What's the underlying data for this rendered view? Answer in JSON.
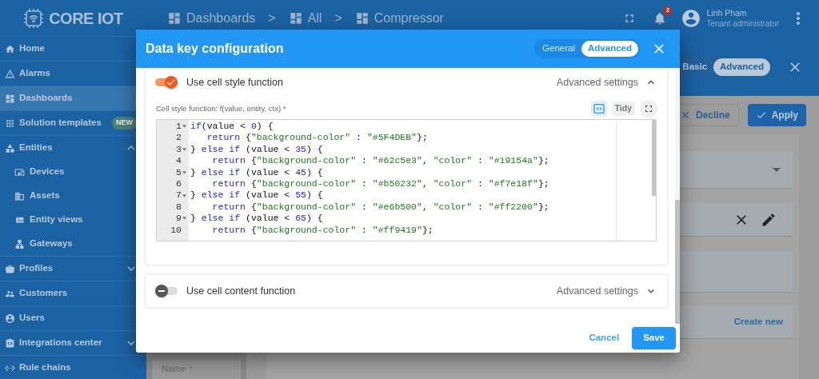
{
  "header": {
    "logo": "CORE IOT",
    "breadcrumbs": [
      "Dashboards",
      "All",
      "Compressor"
    ],
    "separator": ">",
    "notification_count": "2",
    "user": {
      "name": "Linh Phạm",
      "role": "Tenant administrator"
    }
  },
  "sidebar": {
    "items": [
      {
        "label": "Home",
        "selected": false
      },
      {
        "label": "Alarms",
        "selected": false
      },
      {
        "label": "Dashboards",
        "selected": true
      },
      {
        "label": "Solution templates",
        "selected": false,
        "badge": "NEW"
      },
      {
        "label": "Entities",
        "selected": false,
        "expanded": true,
        "children": [
          {
            "label": "Devices",
            "selected": false
          },
          {
            "label": "Assets",
            "selected": false
          },
          {
            "label": "Entity views",
            "selected": false
          },
          {
            "label": "Gateways",
            "selected": false
          }
        ]
      },
      {
        "label": "Profiles",
        "selected": false,
        "expanded": false
      },
      {
        "label": "Customers",
        "selected": false
      },
      {
        "label": "Users",
        "selected": false
      },
      {
        "label": "Integrations center",
        "selected": false,
        "expanded": false
      },
      {
        "label": "Rule chains",
        "selected": false
      }
    ]
  },
  "widget_editor": {
    "tabs": [
      {
        "label": "Basic",
        "selected": false
      },
      {
        "label": "Advanced",
        "selected": true
      }
    ],
    "decline": "Decline",
    "apply": "Apply",
    "create_new": "Create new",
    "column": "Name ↑"
  },
  "dialog": {
    "title": "Data key configuration",
    "tabs": [
      {
        "label": "General",
        "selected": false
      },
      {
        "label": "Advanced",
        "selected": true
      }
    ],
    "sections": [
      {
        "label": "Use cell style function",
        "on": true,
        "expanded": true,
        "settings": "Advanced settings",
        "editor": {
          "label": "Cell style function: f(value, entity, ctx) *",
          "tidy": "Tidy",
          "lines": [
            {
              "number": "1",
              "foldable": true,
              "tokens": [
                {
                  "kind": "keyword",
                  "text": "if"
                },
                {
                  "kind": "plain",
                  "text": "(value < "
                },
                {
                  "kind": "number",
                  "text": "0"
                },
                {
                  "kind": "plain",
                  "text": ") {"
                }
              ]
            },
            {
              "number": "2",
              "foldable": false,
              "tokens": [
                {
                  "kind": "keyword",
                  "text": "   return"
                },
                {
                  "kind": "plain",
                  "text": " {"
                },
                {
                  "kind": "string",
                  "text": "\"background-color\""
                },
                {
                  "kind": "plain",
                  "text": " : "
                },
                {
                  "kind": "string",
                  "text": "\"#5F4DEB\""
                },
                {
                  "kind": "plain",
                  "text": "};"
                }
              ]
            },
            {
              "number": "3",
              "foldable": true,
              "tokens": [
                {
                  "kind": "plain",
                  "text": "} "
                },
                {
                  "kind": "keyword",
                  "text": "else if"
                },
                {
                  "kind": "plain",
                  "text": " (value < "
                },
                {
                  "kind": "number",
                  "text": "35"
                },
                {
                  "kind": "plain",
                  "text": ") {"
                }
              ]
            },
            {
              "number": "4",
              "foldable": false,
              "tokens": [
                {
                  "kind": "keyword",
                  "text": "    return"
                },
                {
                  "kind": "plain",
                  "text": " {"
                },
                {
                  "kind": "string",
                  "text": "\"background-color\""
                },
                {
                  "kind": "plain",
                  "text": " : "
                },
                {
                  "kind": "string",
                  "text": "\"#62c5e3\""
                },
                {
                  "kind": "plain",
                  "text": ", "
                },
                {
                  "kind": "string",
                  "text": "\"color\""
                },
                {
                  "kind": "plain",
                  "text": " : "
                },
                {
                  "kind": "string",
                  "text": "\"#19154a\""
                },
                {
                  "kind": "plain",
                  "text": "};"
                }
              ]
            },
            {
              "number": "5",
              "foldable": true,
              "tokens": [
                {
                  "kind": "plain",
                  "text": "} "
                },
                {
                  "kind": "keyword",
                  "text": "else if"
                },
                {
                  "kind": "plain",
                  "text": " (value < "
                },
                {
                  "kind": "number",
                  "text": "45"
                },
                {
                  "kind": "plain",
                  "text": ") {"
                }
              ]
            },
            {
              "number": "6",
              "foldable": false,
              "tokens": [
                {
                  "kind": "keyword",
                  "text": "    return"
                },
                {
                  "kind": "plain",
                  "text": " {"
                },
                {
                  "kind": "string",
                  "text": "\"background-color\""
                },
                {
                  "kind": "plain",
                  "text": " : "
                },
                {
                  "kind": "string",
                  "text": "\"#b50232\""
                },
                {
                  "kind": "plain",
                  "text": ", "
                },
                {
                  "kind": "string",
                  "text": "\"color\""
                },
                {
                  "kind": "plain",
                  "text": " : "
                },
                {
                  "kind": "string",
                  "text": "\"#f7e18f\""
                },
                {
                  "kind": "plain",
                  "text": "};"
                }
              ]
            },
            {
              "number": "7",
              "foldable": true,
              "tokens": [
                {
                  "kind": "plain",
                  "text": "} "
                },
                {
                  "kind": "keyword",
                  "text": "else if"
                },
                {
                  "kind": "plain",
                  "text": " (value < "
                },
                {
                  "kind": "number",
                  "text": "55"
                },
                {
                  "kind": "plain",
                  "text": ") {"
                }
              ]
            },
            {
              "number": "8",
              "foldable": false,
              "tokens": [
                {
                  "kind": "keyword",
                  "text": "    return"
                },
                {
                  "kind": "plain",
                  "text": " {"
                },
                {
                  "kind": "string",
                  "text": "\"background-color\""
                },
                {
                  "kind": "plain",
                  "text": " : "
                },
                {
                  "kind": "string",
                  "text": "\"#e6b500\""
                },
                {
                  "kind": "plain",
                  "text": ", "
                },
                {
                  "kind": "string",
                  "text": "\"color\""
                },
                {
                  "kind": "plain",
                  "text": " : "
                },
                {
                  "kind": "string",
                  "text": "\"#ff2200\""
                },
                {
                  "kind": "plain",
                  "text": "};"
                }
              ]
            },
            {
              "number": "9",
              "foldable": true,
              "tokens": [
                {
                  "kind": "plain",
                  "text": "} "
                },
                {
                  "kind": "keyword",
                  "text": "else if"
                },
                {
                  "kind": "plain",
                  "text": " (value < "
                },
                {
                  "kind": "number",
                  "text": "65"
                },
                {
                  "kind": "plain",
                  "text": ") {"
                }
              ]
            },
            {
              "number": "10",
              "foldable": false,
              "tokens": [
                {
                  "kind": "keyword",
                  "text": "    return"
                },
                {
                  "kind": "plain",
                  "text": " {"
                },
                {
                  "kind": "string",
                  "text": "\"background-color\""
                },
                {
                  "kind": "plain",
                  "text": " : "
                },
                {
                  "kind": "string",
                  "text": "\"#ff9419\""
                },
                {
                  "kind": "plain",
                  "text": "};"
                }
              ]
            }
          ]
        }
      },
      {
        "label": "Use cell content function",
        "on": false,
        "expanded": false,
        "settings": "Advanced settings"
      }
    ],
    "cancel": "Cancel",
    "save": "Save"
  }
}
